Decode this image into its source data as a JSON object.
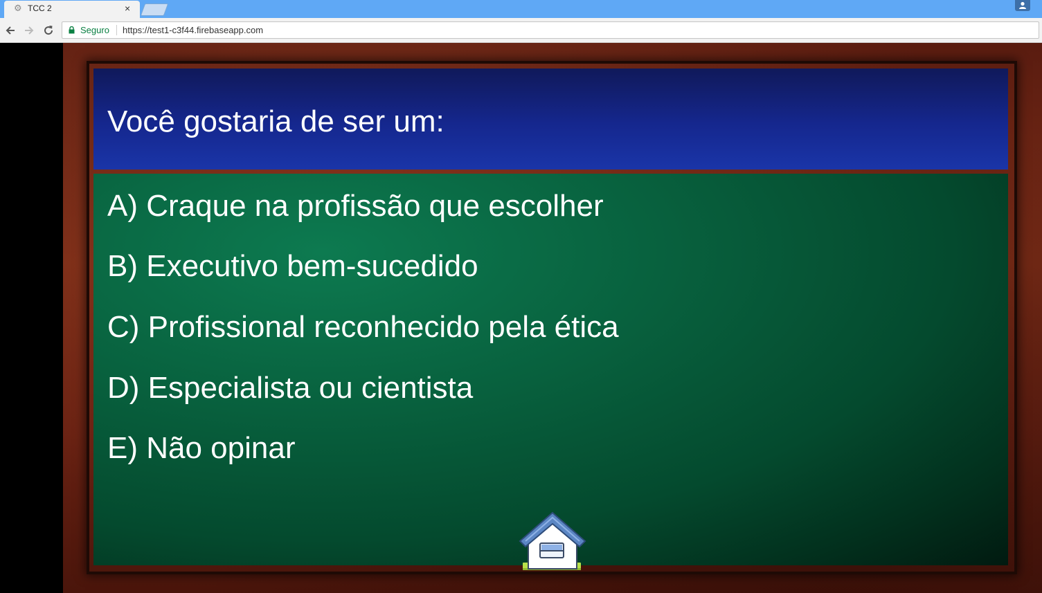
{
  "browser": {
    "tab_title": "TCC 2",
    "tab_close": "×",
    "secure_label": "Seguro",
    "url": "https://test1-c3f44.firebaseapp.com"
  },
  "quiz": {
    "question": "Você gostaria de ser um:",
    "answers": [
      "A) Craque na profissão que escolher",
      "B) Executivo bem-sucedido",
      "C) Profissional reconhecido pela ética",
      "D) Especialista ou cientista",
      "E) Não opinar"
    ]
  },
  "colors": {
    "question_panel": "#15278e",
    "board": "#08613e",
    "frame": "#6a2213",
    "secure": "#0b8043"
  },
  "icons": [
    "gear-icon",
    "close-icon",
    "profile-icon",
    "back-arrow-icon",
    "forward-arrow-icon",
    "reload-icon",
    "lock-icon",
    "home-icon"
  ]
}
